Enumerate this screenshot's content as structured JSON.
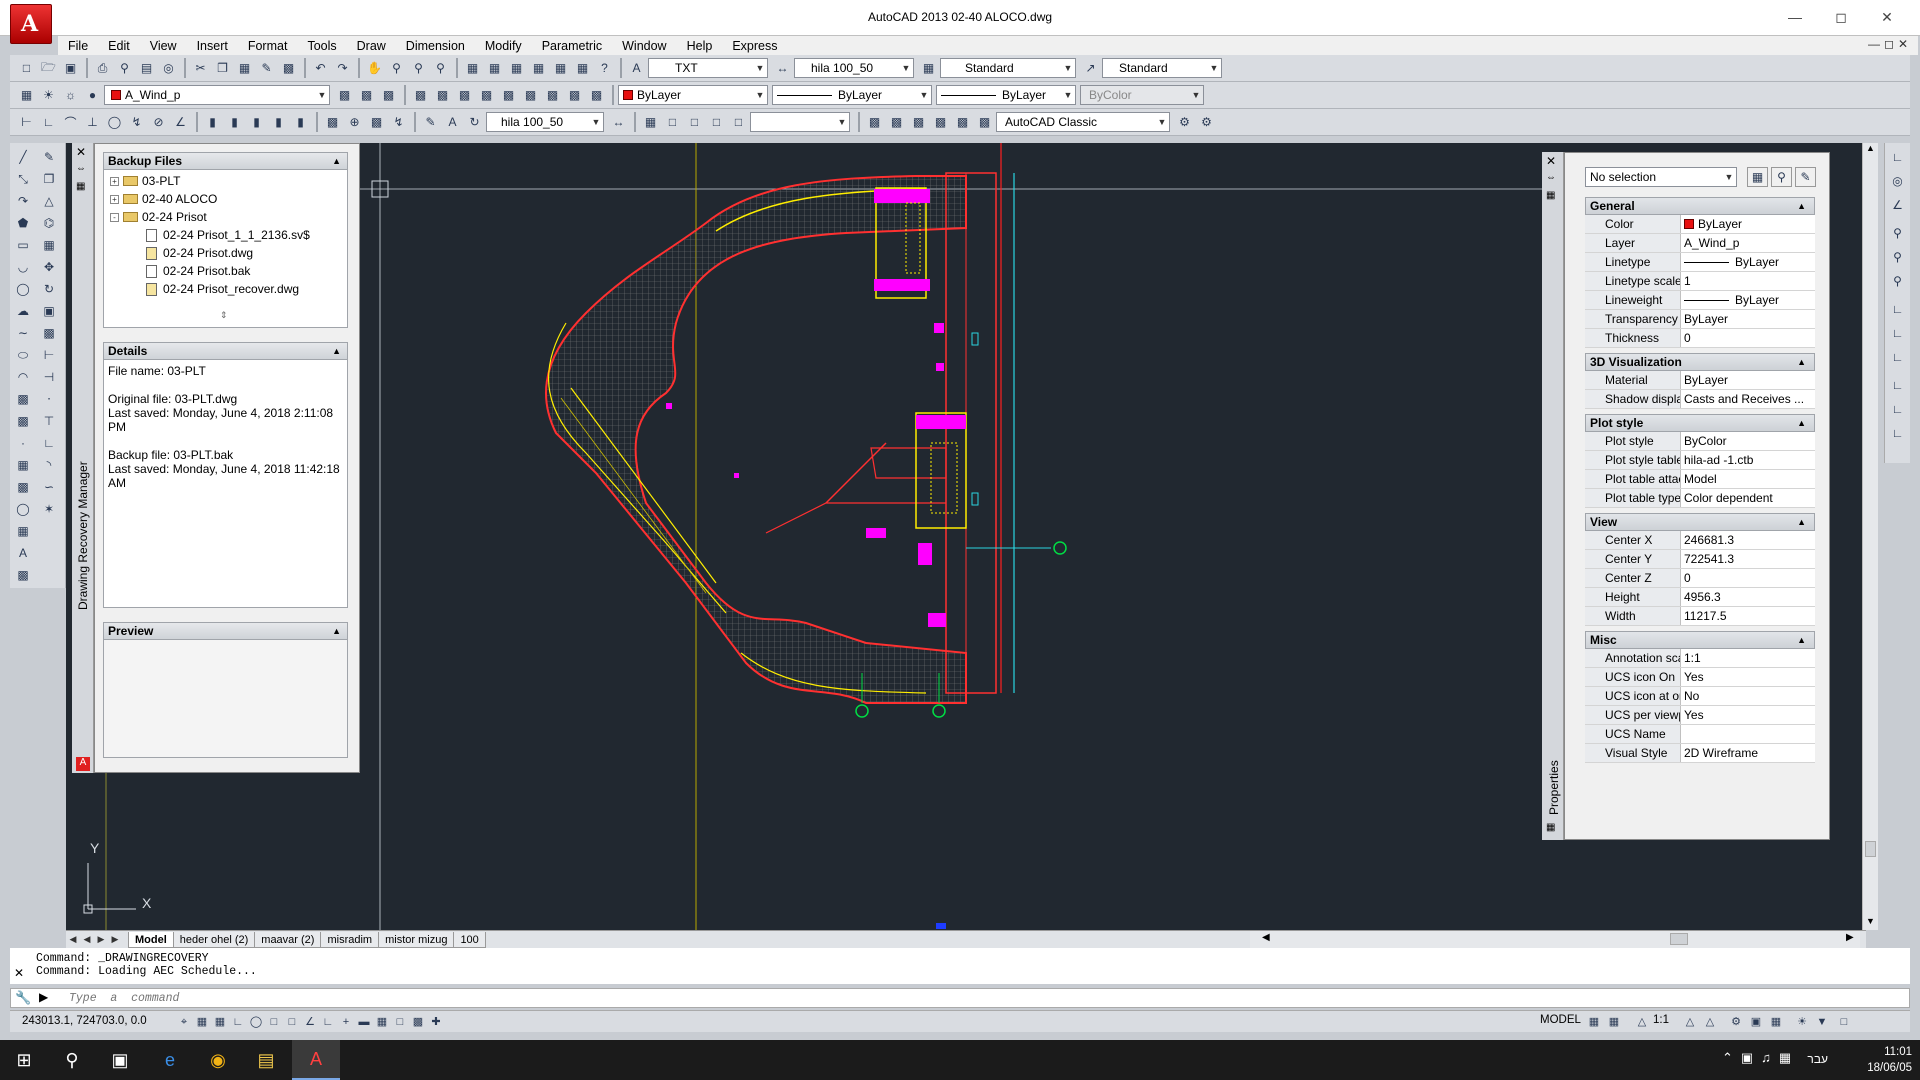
{
  "title": "AutoCAD 2013     02-40 ALOCO.dwg",
  "menu": [
    "File",
    "Edit",
    "View",
    "Insert",
    "Format",
    "Tools",
    "Draw",
    "Dimension",
    "Modify",
    "Parametric",
    "Window",
    "Help",
    "Express"
  ],
  "toolbar1": {
    "text_style": "TXT",
    "dim_style": "hila 100_50",
    "table_style": "Standard",
    "mleader_style": "Standard"
  },
  "toolbar2": {
    "layer": "A_Wind_p",
    "color": "ByLayer",
    "linetype": "ByLayer",
    "lineweight": "ByLayer",
    "plotstyle": "ByColor"
  },
  "toolbar3": {
    "dim_style": "hila 100_50",
    "workspace": "AutoCAD Classic"
  },
  "drm": {
    "vertical_title": "Drawing Recovery Manager",
    "backup_header": "Backup Files",
    "tree": [
      {
        "label": "03-PLT",
        "level": 0,
        "exp": "+"
      },
      {
        "label": "02-40 ALOCO",
        "level": 0,
        "exp": "+"
      },
      {
        "label": "02-24 Prisot",
        "level": 0,
        "exp": "-"
      },
      {
        "label": "02-24 Prisot_1_1_2136.sv$",
        "level": 1
      },
      {
        "label": "02-24 Prisot.dwg",
        "level": 1
      },
      {
        "label": "02-24 Prisot.bak",
        "level": 1
      },
      {
        "label": "02-24 Prisot_recover.dwg",
        "level": 1
      }
    ],
    "details_header": "Details",
    "details": {
      "file_name": "File name: 03-PLT",
      "original": "Original file: 03-PLT.dwg",
      "orig_saved": "Last saved: Monday, June 4, 2018  2:11:08 PM",
      "backup": "Backup file: 03-PLT.bak",
      "backup_saved": "Last saved: Monday, June 4, 2018  11:42:18 AM"
    },
    "preview_header": "Preview"
  },
  "properties": {
    "vertical_title": "Properties",
    "selection": "No selection",
    "categories": [
      {
        "name": "General",
        "rows": [
          {
            "k": "Color",
            "v": "ByLayer"
          },
          {
            "k": "Layer",
            "v": "A_Wind_p"
          },
          {
            "k": "Linetype",
            "v": "ByLayer"
          },
          {
            "k": "Linetype scale",
            "v": "1"
          },
          {
            "k": "Lineweight",
            "v": "ByLayer"
          },
          {
            "k": "Transparency",
            "v": "ByLayer"
          },
          {
            "k": "Thickness",
            "v": "0"
          }
        ]
      },
      {
        "name": "3D Visualization",
        "rows": [
          {
            "k": "Material",
            "v": "ByLayer"
          },
          {
            "k": "Shadow display",
            "v": "Casts and Receives ..."
          }
        ]
      },
      {
        "name": "Plot style",
        "rows": [
          {
            "k": "Plot style",
            "v": "ByColor"
          },
          {
            "k": "Plot style table",
            "v": "hila-ad -1.ctb"
          },
          {
            "k": "Plot table attac...",
            "v": "Model"
          },
          {
            "k": "Plot table type",
            "v": "Color dependent"
          }
        ]
      },
      {
        "name": "View",
        "rows": [
          {
            "k": "Center X",
            "v": "246681.3"
          },
          {
            "k": "Center Y",
            "v": "722541.3"
          },
          {
            "k": "Center Z",
            "v": "0"
          },
          {
            "k": "Height",
            "v": "4956.3"
          },
          {
            "k": "Width",
            "v": "11217.5"
          }
        ]
      },
      {
        "name": "Misc",
        "rows": [
          {
            "k": "Annotation scale",
            "v": "1:1"
          },
          {
            "k": "UCS icon On",
            "v": "Yes"
          },
          {
            "k": "UCS icon at ori...",
            "v": "No"
          },
          {
            "k": "UCS per viewport",
            "v": "Yes"
          },
          {
            "k": "UCS Name",
            "v": ""
          },
          {
            "k": "Visual Style",
            "v": "2D Wireframe"
          }
        ]
      }
    ]
  },
  "layout_tabs": [
    "Model",
    "heder ohel (2)",
    "maavar (2)",
    "misradim",
    "mistor mizug",
    "100"
  ],
  "command_history": [
    "Command:  _DRAWINGRECOVERY",
    "Command:  Loading AEC Schedule..."
  ],
  "command_placeholder": "Type  a  command",
  "status": {
    "coords": "243013.1, 724703.0, 0.0",
    "model": "MODEL",
    "scale": "1:1"
  },
  "ucs": {
    "x": "X",
    "y": "Y"
  },
  "taskbar": {
    "lang": "עבר",
    "time": "11:01",
    "date": "18/06/05"
  },
  "colors": {
    "canvas": "#212830",
    "plan_red": "#ff2020",
    "plan_yellow": "#ffee00",
    "plan_magenta": "#ff00ff",
    "plan_green": "#00dd44"
  }
}
